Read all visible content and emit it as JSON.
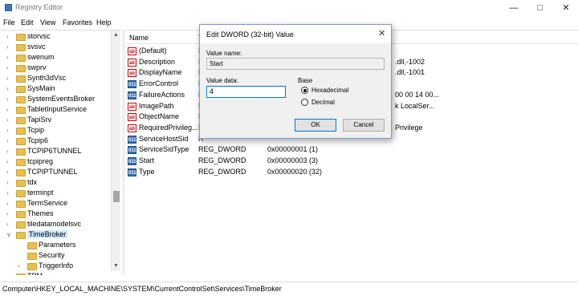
{
  "window": {
    "title": "Registry Editor",
    "icon": "registry-icon"
  },
  "menu": [
    "File",
    "Edit",
    "View",
    "Favorites",
    "Help"
  ],
  "tree": {
    "items": [
      {
        "label": "storvsc",
        "expand": ">",
        "level": 0
      },
      {
        "label": "svsvc",
        "expand": ">",
        "level": 0
      },
      {
        "label": "swenum",
        "expand": ">",
        "level": 0
      },
      {
        "label": "swprv",
        "expand": ">",
        "level": 0
      },
      {
        "label": "Synth3dVsc",
        "expand": ">",
        "level": 0
      },
      {
        "label": "SysMain",
        "expand": ">",
        "level": 0
      },
      {
        "label": "SystemEventsBroker",
        "expand": ">",
        "level": 0
      },
      {
        "label": "TabletInputService",
        "expand": ">",
        "level": 0
      },
      {
        "label": "TapiSrv",
        "expand": ">",
        "level": 0
      },
      {
        "label": "Tcpip",
        "expand": ">",
        "level": 0
      },
      {
        "label": "Tcpip6",
        "expand": ">",
        "level": 0
      },
      {
        "label": "TCPIP6TUNNEL",
        "expand": ">",
        "level": 0
      },
      {
        "label": "tcpipreg",
        "expand": ">",
        "level": 0
      },
      {
        "label": "TCPIPTUNNEL",
        "expand": ">",
        "level": 0
      },
      {
        "label": "tdx",
        "expand": ">",
        "level": 0
      },
      {
        "label": "terminpt",
        "expand": ">",
        "level": 0
      },
      {
        "label": "TermService",
        "expand": ">",
        "level": 0
      },
      {
        "label": "Themes",
        "expand": ">",
        "level": 0
      },
      {
        "label": "tiledatamodelsvc",
        "expand": ">",
        "level": 0
      },
      {
        "label": "TimeBroker",
        "expand": "v",
        "level": 0,
        "selected": true
      },
      {
        "label": "Parameters",
        "expand": "",
        "level": 1
      },
      {
        "label": "Security",
        "expand": "",
        "level": 1
      },
      {
        "label": "TriggerInfo",
        "expand": ">",
        "level": 1
      },
      {
        "label": "TPM",
        "expand": ">",
        "level": 0
      }
    ]
  },
  "values_pane": {
    "col_name": "Name",
    "col_type": "T",
    "rows": [
      {
        "icon": "ab",
        "name": "(Default)",
        "type": "R",
        "data": ""
      },
      {
        "icon": "ab",
        "name": "Description",
        "type": "R",
        "data": ".dll,-1002"
      },
      {
        "icon": "ab",
        "name": "DisplayName",
        "type": "R",
        "data": ".dll,-1001"
      },
      {
        "icon": "bin",
        "name": "ErrorControl",
        "type": "R",
        "data": ""
      },
      {
        "icon": "bin",
        "name": "FailureActions",
        "type": "R",
        "data": "00 00 14 00..."
      },
      {
        "icon": "ab",
        "name": "ImagePath",
        "type": "R",
        "data": "k LocalSer..."
      },
      {
        "icon": "ab",
        "name": "ObjectName",
        "type": "R",
        "data": ""
      },
      {
        "icon": "ab",
        "name": "RequiredPrivileg...",
        "type": "R",
        "data": "Privilege"
      },
      {
        "icon": "bin",
        "name": "ServiceHostSid",
        "type": "R",
        "data": ""
      },
      {
        "icon": "bin",
        "name": "ServiceSidType",
        "type": "REG_DWORD",
        "data": "0x00000001 (1)"
      },
      {
        "icon": "bin",
        "name": "Start",
        "type": "REG_DWORD",
        "data": "0x00000003 (3)"
      },
      {
        "icon": "bin",
        "name": "Type",
        "type": "REG_DWORD",
        "data": "0x00000020 (32)"
      }
    ]
  },
  "status_bar": "Computer\\HKEY_LOCAL_MACHINE\\SYSTEM\\CurrentControlSet\\Services\\TimeBroker",
  "dialog": {
    "title": "Edit DWORD (32-bit) Value",
    "value_name_label": "Value name:",
    "value_name": "Start",
    "value_data_label": "Value data:",
    "value_data": "4",
    "base_label": "Base",
    "hex_label": "Hexadecimal",
    "dec_label": "Decimal",
    "base_selected": "Hexadecimal",
    "ok_label": "OK",
    "cancel_label": "Cancel"
  },
  "colors": {
    "accent": "#0078d7",
    "selection": "#cce8ff",
    "folder": "#e8c04f"
  }
}
